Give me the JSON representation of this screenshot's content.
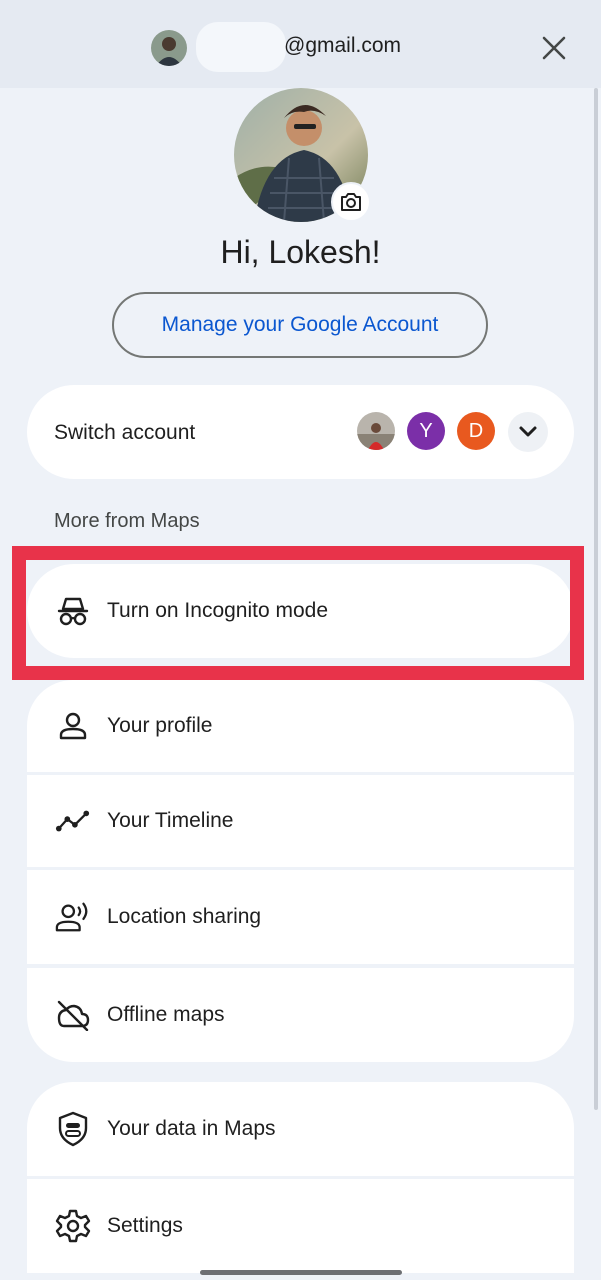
{
  "header": {
    "email": "@gmail.com",
    "avatar_icon": "user-avatar",
    "close_icon": "close-icon"
  },
  "profile": {
    "greeting": "Hi, Lokesh!",
    "camera_icon": "camera-icon",
    "manage_label": "Manage your Google Account"
  },
  "switch_account": {
    "label": "Switch account",
    "accounts": [
      {
        "initial": "",
        "color": "#b9b4ac"
      },
      {
        "initial": "Y",
        "color": "#7b2fa8"
      },
      {
        "initial": "D",
        "color": "#e8591f"
      }
    ],
    "expand_icon": "chevron-down-icon"
  },
  "more_section": {
    "label": "More from Maps"
  },
  "incognito": {
    "label": "Turn on Incognito mode",
    "icon": "incognito-icon"
  },
  "menu_group_1": [
    {
      "label": "Your profile",
      "icon": "person-icon"
    },
    {
      "label": "Your Timeline",
      "icon": "timeline-icon"
    },
    {
      "label": "Location sharing",
      "icon": "location-sharing-icon"
    },
    {
      "label": "Offline maps",
      "icon": "cloud-off-icon"
    }
  ],
  "menu_group_2": [
    {
      "label": "Your data in Maps",
      "icon": "shield-icon"
    },
    {
      "label": "Settings",
      "icon": "gear-icon"
    }
  ],
  "colors": {
    "accent_link": "#0b57d0",
    "highlight_box": "#e8334a",
    "background": "#eef2f8"
  }
}
